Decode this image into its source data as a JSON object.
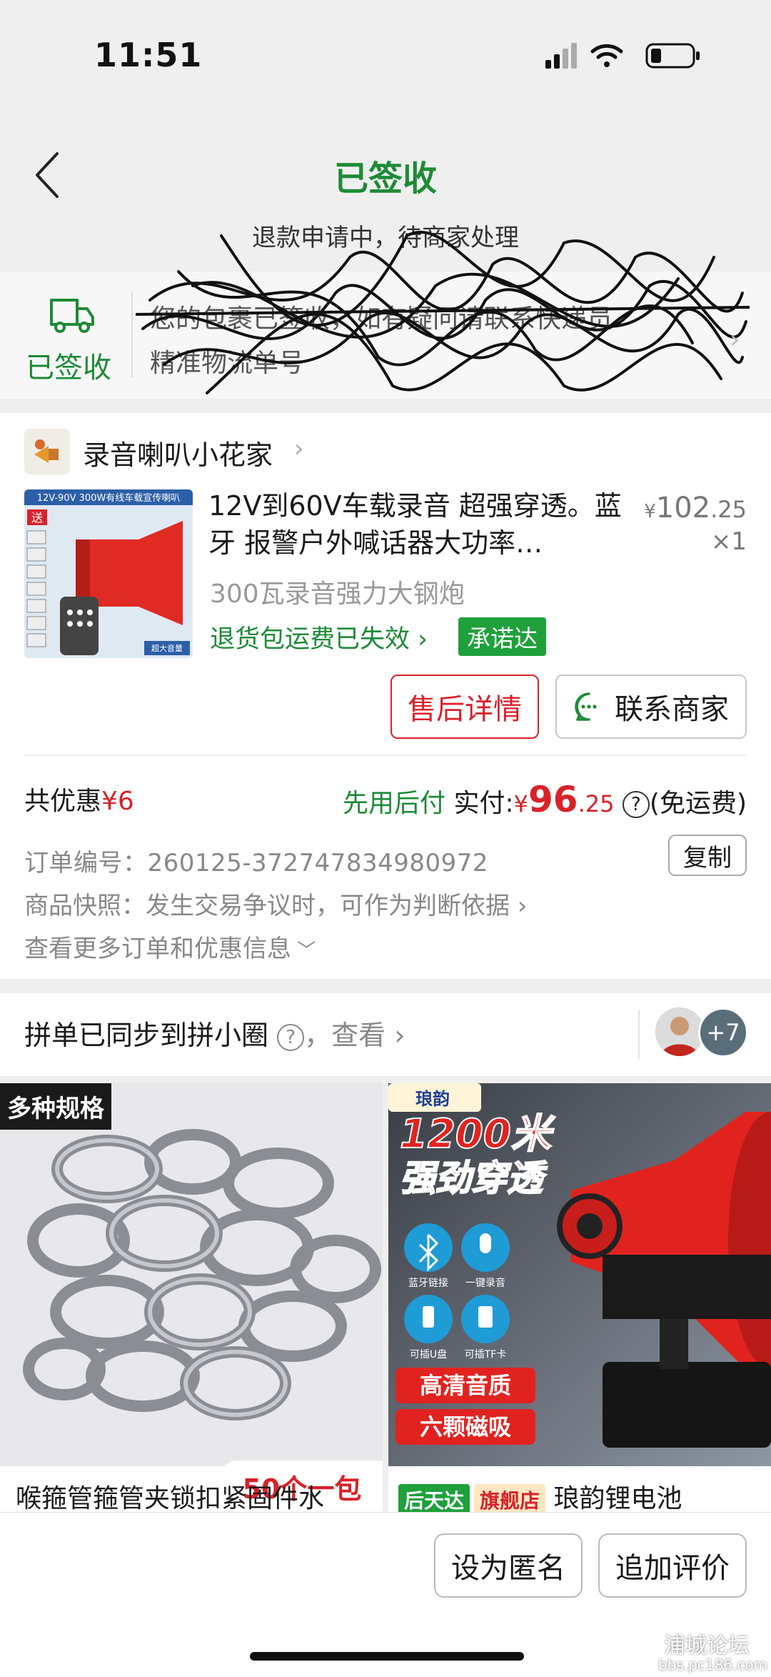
{
  "status_bar": {
    "time": "11:51"
  },
  "header": {
    "title": "已签收",
    "subtitle": "退款申请中，待商家处理"
  },
  "logistics": {
    "status_label": "已签收",
    "line1": "您的包裹已签收，如有疑问请联系快递员",
    "line2": "精准物流单号"
  },
  "shop": {
    "name": "录音喇叭小花家"
  },
  "product": {
    "title": "12V到60V车载录音 超强穿透。蓝牙 报警户外喊话器大功率…",
    "price_symbol": "¥",
    "price_int": "102",
    "price_dec": ".25",
    "quantity": "×1",
    "spec": "300瓦录音强力大钢炮",
    "return_note": "退货包运费已失效",
    "promise_badge": "承诺达",
    "image_banner": "12V-90V 300W有线车载宣传喇叭",
    "image_badge": "超大音量",
    "image_tag": "送"
  },
  "actions": {
    "aftersale": "售后详情",
    "contact": "联系商家"
  },
  "payment": {
    "discount_label": "共优惠",
    "discount_value": "¥6",
    "pay_later": "先用后付",
    "paid_label": "实付:",
    "paid_symbol": "¥",
    "paid_int": "96",
    "paid_dec": ".25",
    "shipping": "(免运费)"
  },
  "order": {
    "number_label": "订单编号：",
    "number": "260125-372747834980972",
    "copy": "复制",
    "snapshot": "商品快照：发生交易争议时，可作为判断依据",
    "more": "查看更多订单和优惠信息"
  },
  "group": {
    "text": "拼单已同步到拼小圈",
    "view": "，查看",
    "count": "+7"
  },
  "recommendations": [
    {
      "title": "喉箍管箍管夹锁扣紧固件水",
      "tag_top": "多种规格",
      "tag_bottom": "50个一包"
    },
    {
      "brand": "琅韵",
      "headline1": "1200米",
      "headline2": "强劲穿透",
      "features": [
        "蓝牙链接",
        "一键录音",
        "可插U盘",
        "可插TF卡"
      ],
      "badge1": "高清音质",
      "badge2": "六颗磁吸",
      "tag_fast": "后天达",
      "tag_flag": "旗舰店",
      "title": "琅韵锂电池"
    }
  ],
  "bottom": {
    "anonymous": "设为匿名",
    "review": "追加评价"
  },
  "watermark": {
    "main": "浦城论坛",
    "sub": "bbs.pc186.com"
  },
  "colors": {
    "green": "#1e8a37",
    "red": "#d8222a",
    "badge_green": "#1ea13a"
  }
}
